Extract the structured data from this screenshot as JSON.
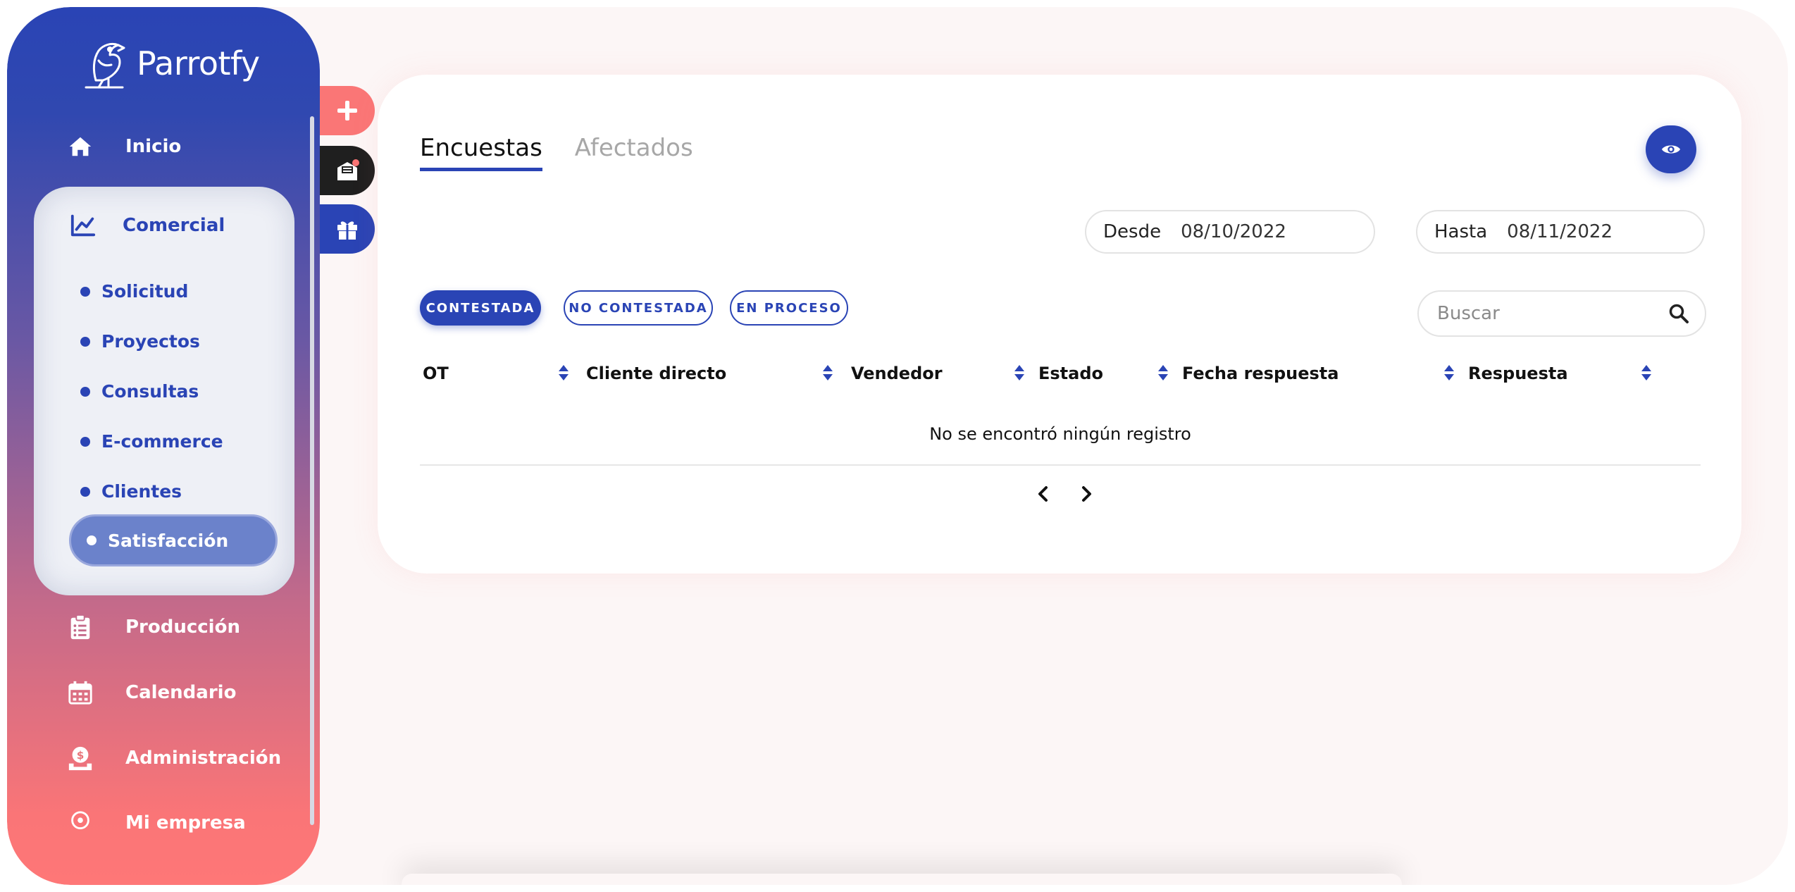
{
  "brand": {
    "name": "Parrotfy"
  },
  "sidebar": {
    "items": [
      {
        "label": "Inicio",
        "icon": "home-icon"
      },
      {
        "label": "Comercial",
        "icon": "chart-line-icon"
      },
      {
        "label": "Producción",
        "icon": "clipboard-list-icon"
      },
      {
        "label": "Calendario",
        "icon": "calendar-icon"
      },
      {
        "label": "Administración",
        "icon": "money-hand-icon"
      },
      {
        "label": "Mi empresa",
        "icon": "building-icon"
      }
    ],
    "submenu": [
      {
        "label": "Solicitud"
      },
      {
        "label": "Proyectos"
      },
      {
        "label": "Consultas"
      },
      {
        "label": "E-commerce"
      },
      {
        "label": "Clientes"
      },
      {
        "label": "Satisfacción",
        "active": true
      }
    ]
  },
  "fabs": [
    {
      "icon": "plus-icon",
      "color": "#fa7676"
    },
    {
      "icon": "inbox-icon",
      "color": "#1f1f1f"
    },
    {
      "icon": "gift-icon",
      "color": "#2a44b5"
    }
  ],
  "tabs": [
    {
      "label": "Encuestas",
      "active": true
    },
    {
      "label": "Afectados",
      "active": false
    }
  ],
  "filters": {
    "desde_label": "Desde",
    "desde_value": "08/10/2022",
    "hasta_label": "Hasta",
    "hasta_value": "08/11/2022"
  },
  "status_pills": [
    {
      "label": "CONTESTADA",
      "active": true
    },
    {
      "label": "NO CONTESTADA",
      "active": false
    },
    {
      "label": "EN PROCESO",
      "active": false
    }
  ],
  "search": {
    "placeholder": "Buscar"
  },
  "table": {
    "columns": [
      "OT",
      "Cliente directo",
      "Vendedor",
      "Estado",
      "Fecha respuesta",
      "Respuesta"
    ],
    "empty_message": "No se encontró ningún registro"
  },
  "colors": {
    "primary": "#2a44b5",
    "accent": "#fa7676",
    "dark": "#1f1f1f"
  }
}
